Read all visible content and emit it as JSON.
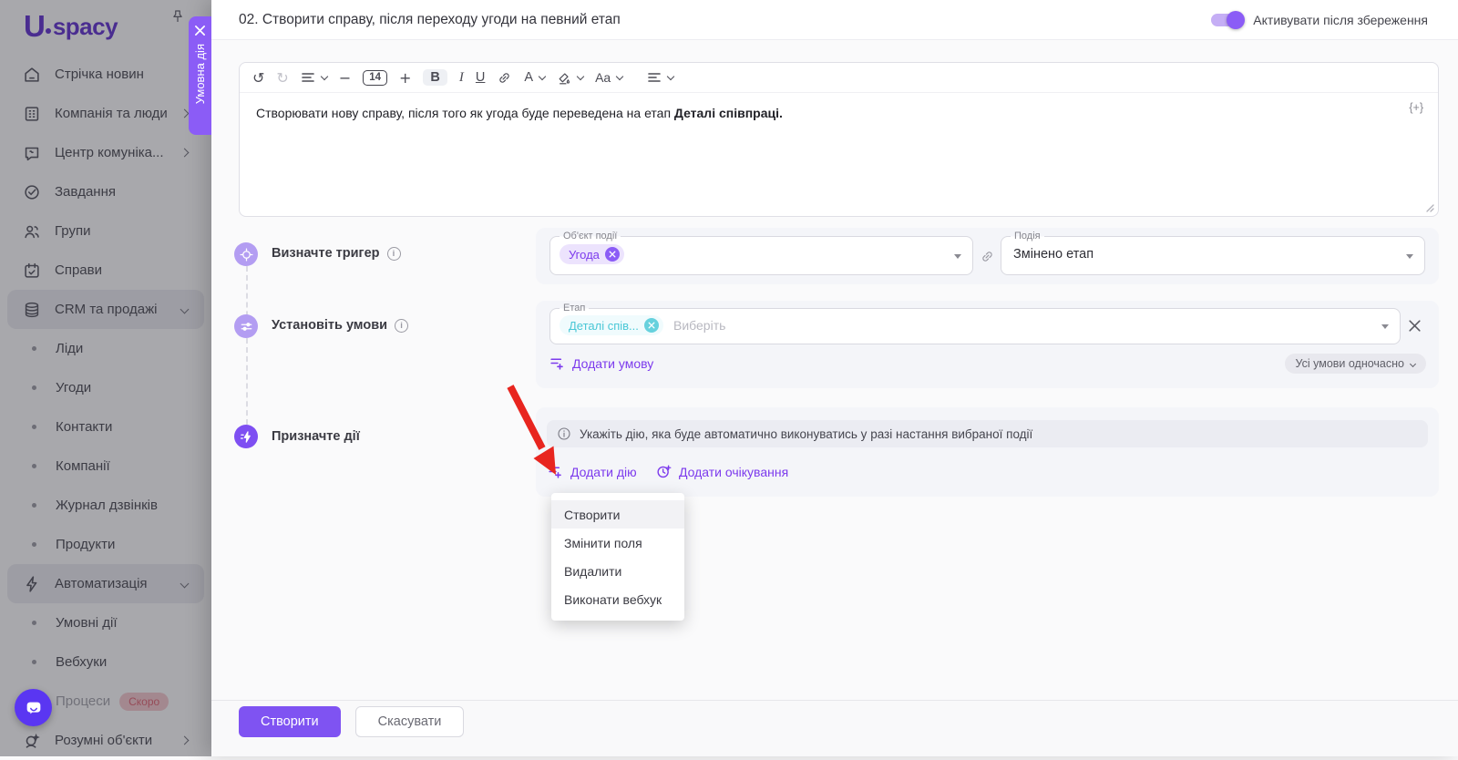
{
  "sidebar": {
    "logo_letter": "U",
    "logo_rest": "spacy",
    "items": [
      {
        "label": "Стрічка новин",
        "icon": "home-icon"
      },
      {
        "label": "Компанія та люди",
        "icon": "company-icon",
        "chevron": "right"
      },
      {
        "label": "Центр комуніка...",
        "icon": "communications-icon",
        "chevron": "right"
      },
      {
        "label": "Завдання",
        "icon": "tasks-icon"
      },
      {
        "label": "Групи",
        "icon": "groups-icon"
      },
      {
        "label": "Справи",
        "icon": "activities-icon"
      },
      {
        "label": "CRM та продажі",
        "icon": "crm-icon",
        "chevron": "down",
        "active": true
      },
      {
        "label": "Ліди",
        "bullet": true
      },
      {
        "label": "Угоди",
        "bullet": true
      },
      {
        "label": "Контакти",
        "bullet": true
      },
      {
        "label": "Компанії",
        "bullet": true
      },
      {
        "label": "Журнал дзвінків",
        "bullet": true
      },
      {
        "label": "Продукти",
        "bullet": true
      },
      {
        "label": "Автоматизація",
        "icon": "automation-icon",
        "chevron": "down",
        "active": true
      },
      {
        "label": "Умовні дії",
        "bullet": true
      },
      {
        "label": "Вебхуки",
        "bullet": true
      },
      {
        "label": "Процеси",
        "bullet": true,
        "badge": "Скоро",
        "disabled": true
      },
      {
        "label": "Розумні об'єкти",
        "icon": "smart-objects-icon",
        "chevron": "right"
      }
    ]
  },
  "drawer_tab": {
    "label": "Умовна дія"
  },
  "header": {
    "title": "02. Створити справу, після переходу угоди на певний етап",
    "toggle_label": "Активувати після збереження",
    "toggle_on": true
  },
  "editor": {
    "font_size": "14",
    "text_regular": "Створювати нову справу, після того як угода буде переведена на етап ",
    "text_bold": "Деталі співпраці.",
    "insert_token": "{+}"
  },
  "steps": {
    "trigger": {
      "label": "Визначте тригер",
      "object_label": "Об'єкт події",
      "object_chip": "Угода",
      "event_label": "Подія",
      "event_value": "Змінено етап"
    },
    "conditions": {
      "label": "Установіть умови",
      "field_label": "Етап",
      "chip": "Деталі спів...",
      "placeholder": "Виберіть",
      "add_link": "Додати умову",
      "mode_pill": "Усі умови одночасно"
    },
    "actions": {
      "label": "Призначте дії",
      "hint": "Укажіть дію, яка буде автоматично виконуватись у разі настання вибраної події",
      "add_action": "Додати дію",
      "add_wait": "Додати очікування"
    }
  },
  "menu": {
    "items": [
      "Створити",
      "Змінити поля",
      "Видалити",
      "Виконати вебхук"
    ],
    "active_index": 0
  },
  "footer": {
    "submit": "Створити",
    "cancel": "Скасувати"
  },
  "colors": {
    "accent": "#7c3aed",
    "tab": "#8b5cf6",
    "step_light": "#b39df2",
    "step_active": "#7e4ff2",
    "cyan": "#49c7d6",
    "arrow_red": "#e8251f",
    "button": "#7f53f2"
  }
}
